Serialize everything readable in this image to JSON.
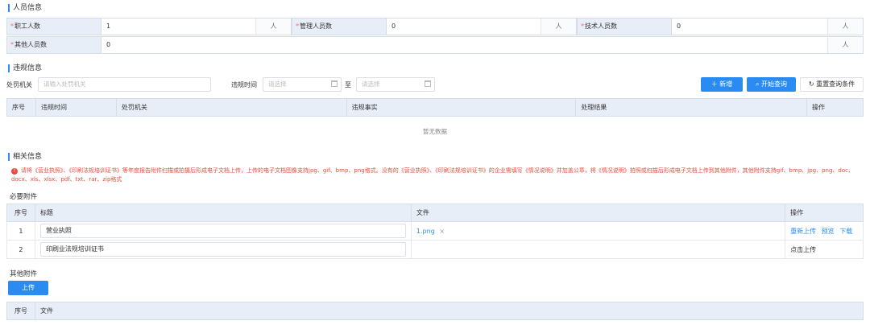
{
  "personnel": {
    "title": "人员信息",
    "fields": [
      {
        "label": "职工人数",
        "required": "*",
        "value": "1",
        "unit": "人"
      },
      {
        "label": "管理人员数",
        "required": "*",
        "value": "0",
        "unit": "人"
      },
      {
        "label": "技术人员数",
        "required": "*",
        "value": "0",
        "unit": "人"
      },
      {
        "label": "其他人员数",
        "required": "*",
        "value": "0",
        "unit": "人"
      }
    ]
  },
  "violation": {
    "title": "违规信息",
    "filters": {
      "org_label": "处罚机关",
      "org_placeholder": "请输入处罚机关",
      "time_label": "违规时间",
      "date_placeholder": "请选择",
      "to_label": "至"
    },
    "buttons": {
      "add": "＋ 新增",
      "search": "开始查询",
      "reset": "重置查询条件"
    },
    "columns": [
      "序号",
      "违规时间",
      "处罚机关",
      "违规事实",
      "处理结果",
      "操作"
    ],
    "empty_text": "暂无数据"
  },
  "related": {
    "title": "相关信息",
    "notice": "请将《营业执照》、《印刷法规培训证书》等年度报告附件扫描或拍摄后形成电子文档上传，上传的电子文档图像支持jpg、gif、bmp、png格式。没有的《营业执照》、《印刷法规培训证书》的企业需填写《情况说明》并加盖公章，将《情况说明》拍照或扫描后形成电子文档上传到其他附件，其他附件支持gif、bmp、jpg、png、doc、docx、xls、xlsx、pdf、txt、rar、zip格式",
    "required_attachments": {
      "title": "必要附件",
      "columns": [
        "序号",
        "标题",
        "文件",
        "操作"
      ],
      "rows": [
        {
          "index": "1",
          "title": "营业执照",
          "file": "1.png",
          "remove": "×",
          "actions": [
            "重新上传",
            "预览",
            "下载"
          ]
        },
        {
          "index": "2",
          "title": "印刷业法规培训证书",
          "file": "",
          "actions": [
            "点击上传"
          ]
        }
      ]
    },
    "other_attachments": {
      "title": "其他附件",
      "upload_button": "上传",
      "columns": [
        "序号",
        "文件"
      ]
    }
  }
}
